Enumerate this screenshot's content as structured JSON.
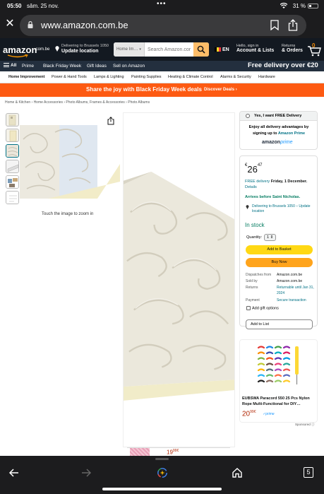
{
  "status_bar": {
    "time": "05:50",
    "date": "sâm. 25 nov.",
    "battery": "31 %"
  },
  "browser": {
    "url": "www.amazon.com.be",
    "tab_count": "5"
  },
  "header": {
    "logo_text": "amazon",
    "logo_suffix": ".com.be",
    "deliver_line1": "Delivering to Brussels 1050",
    "deliver_line2": "Update location",
    "search_category": "Home Im…",
    "search_placeholder": "Search Amazon.cor",
    "language": "EN",
    "account_line1": "Hello, sign in",
    "account_line2": "Account & Lists",
    "returns_line1": "Returns",
    "returns_line2": "& Orders",
    "cart_count": "0"
  },
  "nav": {
    "all_label": "All",
    "items": [
      "Prime",
      "Black Friday Week",
      "Gift Ideas",
      "Sell on Amazon"
    ],
    "free_delivery": "Free delivery over €20"
  },
  "subnav": [
    "Home Improvement",
    "Power & Hand Tools",
    "Lamps & Lighting",
    "Painting Supplies",
    "Heating & Climate Control",
    "Alarms & Security",
    "Hardware"
  ],
  "promo": {
    "text": "Share the joy with Black Friday Week deals",
    "link": "Discover Deals ›"
  },
  "breadcrumb": "Home & Kitchen › Home Accessories › Photo Albums, Frames & Accessories › Photo Albums",
  "gallery": {
    "zoom_hint": "Touch the image to zoom in"
  },
  "free_delivery_box": {
    "checkbox_label": "Yes, I want FREE Delivery",
    "text_before": "Enjoy all delivery advantages by signing up to",
    "prime_link": "Amazon Prime",
    "prime_logo": "amazon",
    "prime_logo_suffix": "prime"
  },
  "buybox": {
    "currency": "€",
    "price_whole": "26",
    "price_fraction": "47",
    "free_delivery_link": "FREE delivery",
    "delivery_date": "Friday, 1 December.",
    "details_link": "Details",
    "arrives": "Arrives before Saint Nicholas.",
    "deliver_to": "Delivering to Brussels 1050 – Update location",
    "stock": "In stock",
    "quantity_label": "Quantity:",
    "quantity_value": "1",
    "add_to_basket": "Add to Basket",
    "buy_now": "Buy Now",
    "dispatches_from_k": "Dispatches from",
    "dispatches_from_v": "Amazon.com.be",
    "sold_by_k": "Sold by",
    "sold_by_v": "Amazon.com.be",
    "returns_k": "Returns",
    "returns_v": "Returnable until Jan 31, 2024",
    "payment_k": "Payment",
    "payment_v": "Secure transaction",
    "gift_label": "Add gift options",
    "add_to_list": "Add to List"
  },
  "sponsored_ad": {
    "title": "EUBSWA Paracord 550 25 Pcs Nylon Rope Multi-Functional for DIY…",
    "price_whole": "20",
    "price_fraction": "99",
    "currency": "€",
    "prime": "✓prime",
    "sponsored": "Sponsored"
  },
  "recommendation": {
    "price_whole": "19",
    "price_fraction": "99",
    "currency": "€"
  },
  "colors": {
    "amazon_dark": "#131921",
    "nav": "#232f3e",
    "promo": "#fd5a12",
    "basket": "#ffd814",
    "buy_now": "#ffa41c",
    "link": "#007185",
    "stock_green": "#067d62"
  }
}
